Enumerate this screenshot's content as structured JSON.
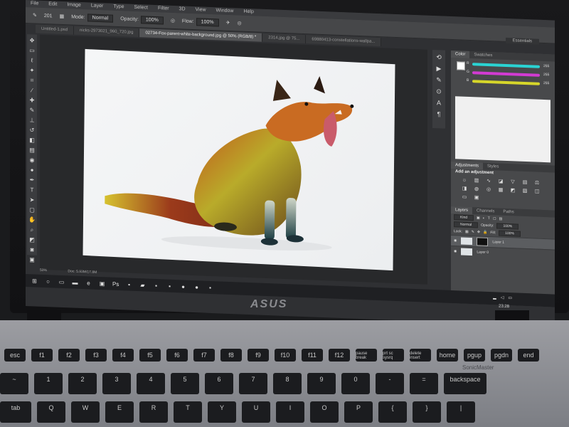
{
  "menu": [
    "File",
    "Edit",
    "Image",
    "Layer",
    "Type",
    "Select",
    "Filter",
    "3D",
    "View",
    "Window",
    "Help"
  ],
  "options_bar": {
    "brush_size": "201",
    "mode_label": "Mode:",
    "mode_value": "Normal",
    "opacity_label": "Opacity:",
    "opacity_value": "100%",
    "flow_label": "Flow:",
    "flow_value": "100%",
    "workspace": "Essentials"
  },
  "doc_tabs": [
    "Untitled-1.psd",
    "nicks-2973021_960_720.jpg",
    "02734-Fox-parent-white-background.jpg @ 50% (RGB/8) *",
    "2314.jpg @ 75...",
    "69880413-constellations-wallpa..."
  ],
  "status": {
    "zoom": "50%",
    "doc": "Doc: 5.93M/17.8M"
  },
  "color_panel": {
    "tabs": [
      "Color",
      "Swatches"
    ],
    "channels": [
      {
        "label": "R",
        "value": "255",
        "color": "#2ad3d3"
      },
      {
        "label": "G",
        "value": "255",
        "color": "#d23bd2"
      },
      {
        "label": "B",
        "value": "255",
        "color": "#d6d62a"
      }
    ]
  },
  "adjustments": {
    "tabs": [
      "Adjustments",
      "Styles"
    ],
    "heading": "Add an adjustment"
  },
  "layers_panel": {
    "tabs": [
      "Layers",
      "Channels",
      "Paths"
    ],
    "kind": "Kind",
    "blend": "Normal",
    "opacity_label": "Opacity:",
    "opacity_value": "100%",
    "lock_label": "Lock:",
    "fill_label": "Fill:",
    "fill_value": "100%",
    "layers": [
      {
        "name": "Layer 1",
        "selected": true
      },
      {
        "name": "Layer 0",
        "selected": false
      }
    ]
  },
  "taskbar": {
    "time": "23:28"
  },
  "laptop": {
    "brand": "ASUS",
    "deck_label": "SonicMaster"
  },
  "keyboard": {
    "row1": [
      "esc",
      "f1",
      "f2",
      "f3",
      "f4",
      "f5",
      "f6",
      "f7",
      "f8",
      "f9",
      "f10",
      "f11",
      "f12",
      "pause break",
      "prt sc sysrq",
      "delete insert",
      "home",
      "pgup",
      "pgdn",
      "end"
    ],
    "row2": [
      "~",
      "1",
      "2",
      "3",
      "4",
      "5",
      "6",
      "7",
      "8",
      "9",
      "0",
      "-",
      "=",
      "backspace"
    ],
    "row3": [
      "tab",
      "Q",
      "W",
      "E",
      "R",
      "T",
      "Y",
      "U",
      "I",
      "O",
      "P",
      "{",
      "}",
      "|"
    ]
  }
}
